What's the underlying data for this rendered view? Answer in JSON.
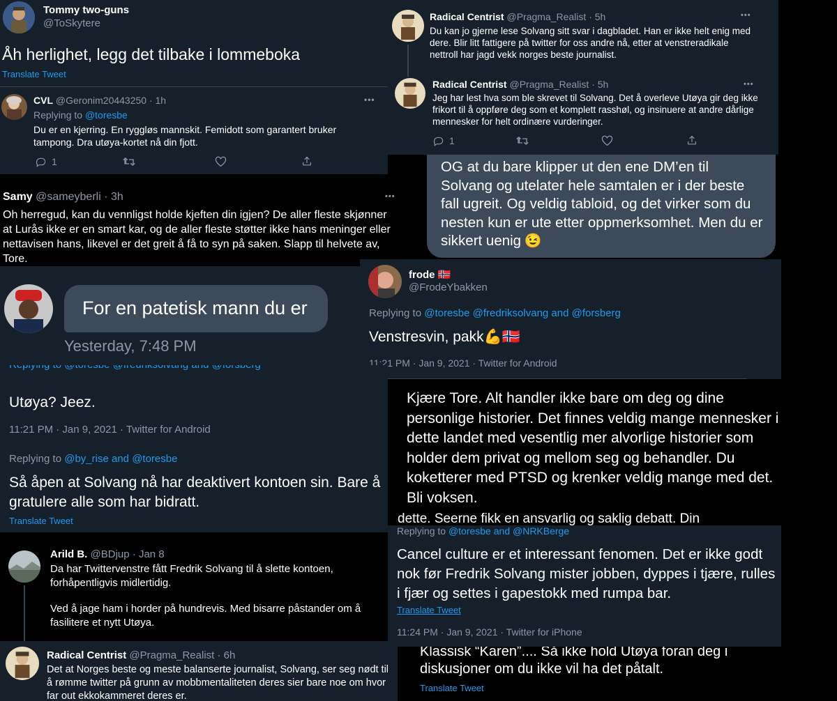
{
  "p1": {
    "name": "Tommy two-guns",
    "handle": "@ToSkytere",
    "text": "Åh herlighet, legg det tilbake i lommeboka",
    "translate": "Translate Tweet"
  },
  "p2": {
    "name": "CVL",
    "handle": "@Geronim20443250",
    "time": "· 1h",
    "replying_prefix": "Replying to",
    "replying_to": "@toresbe",
    "text": "Du er en kjerring. En ryggløs mannskit. Femidott som garantert bruker tampong. Dra utøya-kortet nå din fjott.",
    "reply_count": "1"
  },
  "p3": {
    "tweet1": {
      "name": "Radical Centrist",
      "handle": "@Pragma_Realist",
      "time": "· 5h",
      "text": "Du kan jo gjerne lese Solvang sitt svar i dagbladet. Han er ikke helt enig med dere. Blir litt fattigere på twitter for oss andre nå, etter at venstreradikale nettroll har jagd vekk norges beste journalist."
    },
    "tweet2": {
      "name": "Radical Centrist",
      "handle": "@Pragma_Realist",
      "time": "· 5h",
      "text": "Jeg har lest hva som ble skrevet til Solvang. Det å overleve Utøya gir deg ikke frikort til å oppføre deg som et komplett rasshøl, og insinuere at andre dårlige mennesker for helt ordinære vurderinger.",
      "reply_count": "1"
    }
  },
  "p4": {
    "text": "OG at du bare klipper ut den ene DM’en til Solvang og utelater hele samtalen er i der beste fall ugreit. Og veldig tabloid, og det virker som du nesten kun er ute etter oppmerksomhet. Men du er sikkert uenig",
    "emoji": "😉"
  },
  "p5": {
    "name": "Samy",
    "handle": "@sameyberli",
    "time": "· 3h",
    "text": "Oh herregud, kan du vennligst holde kjeften din igjen? De aller fleste skjønner at Lurås ikke er en smart kar, og de aller fleste støtter ikke hans meninger eller nettavisen hans, likevel er det greit å få to syn på saken. Slapp til helvete av, Tore."
  },
  "p6": {
    "message": "For en patetisk mann du er",
    "timestamp": "Yesterday, 7:48 PM"
  },
  "p7": {
    "name": "frode",
    "flag": "🇳🇴",
    "handle": "@FrodeYbakken",
    "replying_prefix": "Replying to",
    "replying_to": "@toresbe @fredriksolvang",
    "replying_and": "and",
    "replying_last": "@forsberg",
    "text": "Venstresvin, pakk",
    "emoji": "💪🇳🇴",
    "meta": "11:21 PM · Jan 9, 2021 · Twitter for Android"
  },
  "p8": {
    "replying_fragment": "Replying to @toresbe @fredriksolvang and @forsberg",
    "text1": "Utøya? Jeez.",
    "meta1": "11:21 PM · Jan 9, 2021 · Twitter for Android",
    "replying_prefix": "Replying to",
    "replying_to": "@by_rise",
    "replying_and": "and",
    "replying_last": "@toresbe",
    "text2": "Så åpen at Solvang nå har deaktivert kontoen sin. Bare å gratulere alle som har bidratt.",
    "translate": "Translate Tweet"
  },
  "p9": {
    "text": "Kjære Tore. Alt handler ikke bare om deg og dine personlige historier. Det finnes veldig mange mennesker i dette landet med vesentlig mer alvorlige historier som holder dem privat og mellom seg og behandler. Du koketterer med PTSD og krenker veldig mange med det. Bli voksen.",
    "fragment": "dette. Seerne fikk en ansvarlig og saklig debatt. Din"
  },
  "p10": {
    "name": "Arild B.",
    "handle": "@BDjup",
    "time": "· Jan 8",
    "text1": "Da har Twittervenstre fått Fredrik Solvang til å slette kontoen, forhåpentligvis midlertidig.",
    "text2": "Ved å jage ham i horder på hundrevis. Med bisarre påstander om å fasilitere et nytt Utøya."
  },
  "p11": {
    "replying_prefix": "Replying to",
    "replying_to": "@toresbe",
    "replying_and": "and",
    "replying_last": "@NRKBerge",
    "text": "Cancel culture er et interessant fenomen. Det er ikke godt nok før Fredrik Solvang mister jobben, dyppes i tjære, rulles i fjær og settes i gapestokk med rumpa bar.",
    "translate": "Translate Tweet",
    "meta": "11:24 PM · Jan 9, 2021 · Twitter for iPhone"
  },
  "p12": {
    "name": "Radical Centrist",
    "handle": "@Pragma_Realist",
    "time": "· 6h",
    "text": "Det at Norges beste og meste balanserte journalist, Solvang, ser seg nødt til å rømme twitter på grunn av mobbmentaliteten deres sier bare noe om hvor far out ekkokammeret deres er."
  },
  "p13": {
    "fragment": "Klassisk “Karen”.... Så ikke hold Utøya foran deg i",
    "text": "diskusjoner om du ikke vil ha det påtalt.",
    "translate": "Translate Tweet"
  },
  "colors": {
    "background": "#15202b",
    "link": "#1d9bf0",
    "muted": "#8b98a5",
    "bubble": "#3d4a59"
  }
}
